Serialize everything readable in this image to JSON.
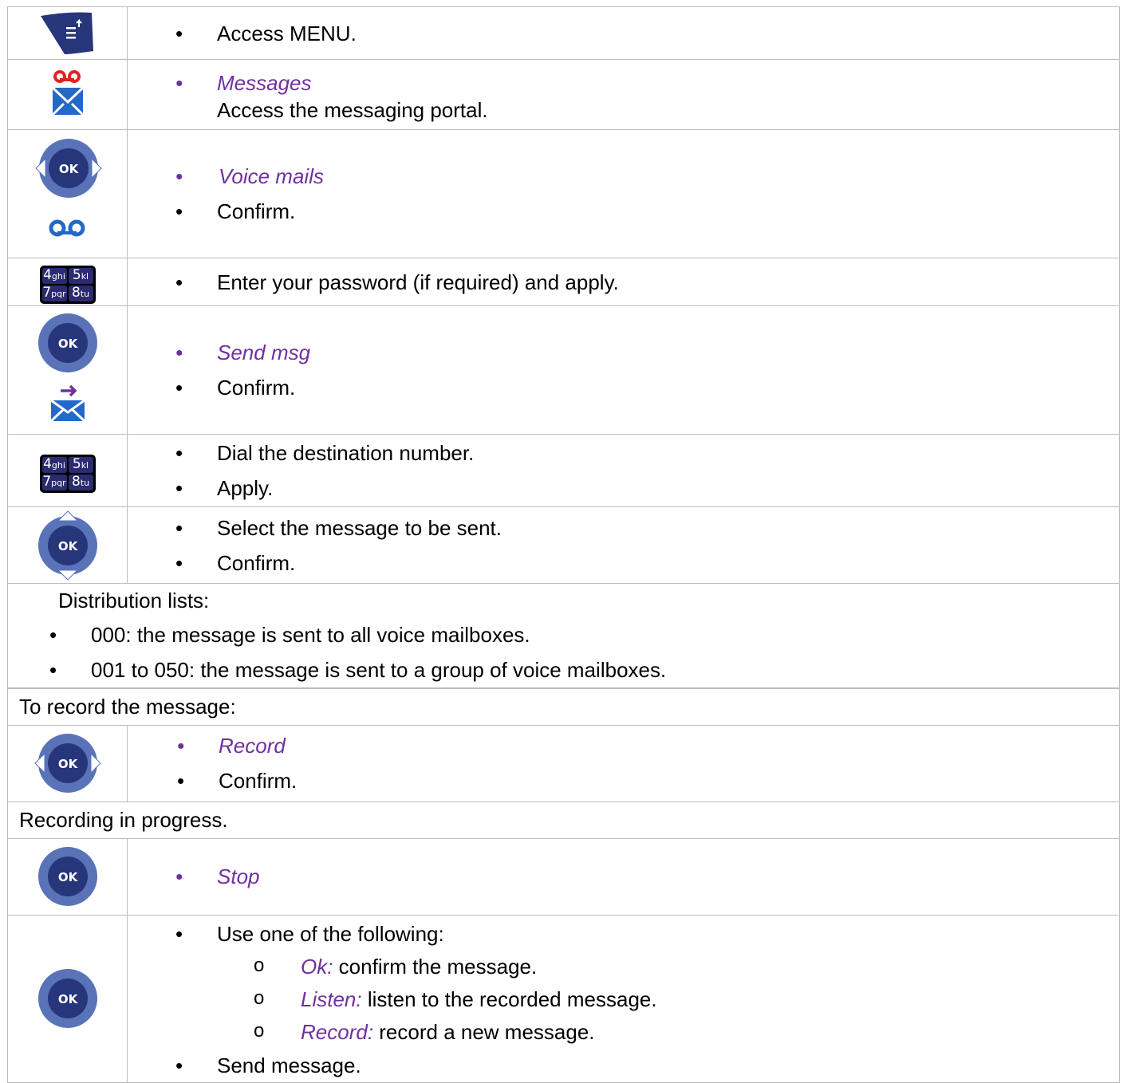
{
  "rows": {
    "menu": {
      "text": "Access MENU."
    },
    "messages": {
      "label": "Messages",
      "desc": "Access the messaging portal."
    },
    "voice_mails": {
      "label": "Voice mails",
      "confirm": "Confirm."
    },
    "password": {
      "text": "Enter your password (if required) and apply."
    },
    "send_msg": {
      "label": "Send msg",
      "confirm": "Confirm."
    },
    "dial": {
      "text": "Dial the destination number.",
      "apply": "Apply."
    },
    "select": {
      "text": "Select the message to be sent.",
      "confirm": "Confirm."
    },
    "distribution": {
      "title": "Distribution lists:",
      "items": [
        "000: the message is sent to all voice mailboxes.",
        "001 to 050: the message is sent to a group of voice mailboxes."
      ]
    },
    "record_heading": "To record the message:",
    "record": {
      "label": "Record",
      "confirm": "Confirm."
    },
    "progress_heading": "Recording in progress.",
    "stop": {
      "label": "Stop"
    },
    "options": {
      "intro": "Use one of the following:",
      "items": [
        {
          "label": "Ok:",
          "text": " confirm the message."
        },
        {
          "label": "Listen:",
          "text": " listen to the recorded message."
        },
        {
          "label": "Record:",
          "text": " record a new message."
        }
      ],
      "final": "Send message."
    }
  },
  "icons": {
    "ok_key": "OK",
    "keypad": [
      {
        "num": "4",
        "letters": "ghi"
      },
      {
        "num": "5",
        "letters": "kl"
      },
      {
        "num": "7",
        "letters": "pqr"
      },
      {
        "num": "8",
        "letters": "tu"
      }
    ]
  },
  "colors": {
    "italic_accent": "#7030a0",
    "ok_ring": "#5a73b8",
    "ok_center": "#27367a",
    "envelope": "#2468c8",
    "voicemail_red": "#e32222"
  }
}
